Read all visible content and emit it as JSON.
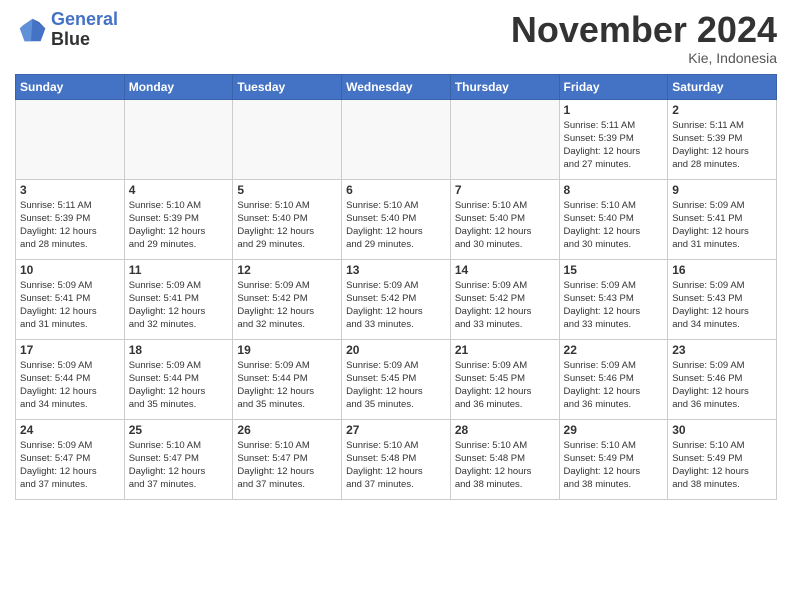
{
  "header": {
    "logo_line1": "General",
    "logo_line2": "Blue",
    "month": "November 2024",
    "location": "Kie, Indonesia"
  },
  "weekdays": [
    "Sunday",
    "Monday",
    "Tuesday",
    "Wednesday",
    "Thursday",
    "Friday",
    "Saturday"
  ],
  "weeks": [
    [
      {
        "day": "",
        "info": ""
      },
      {
        "day": "",
        "info": ""
      },
      {
        "day": "",
        "info": ""
      },
      {
        "day": "",
        "info": ""
      },
      {
        "day": "",
        "info": ""
      },
      {
        "day": "1",
        "info": "Sunrise: 5:11 AM\nSunset: 5:39 PM\nDaylight: 12 hours\nand 27 minutes."
      },
      {
        "day": "2",
        "info": "Sunrise: 5:11 AM\nSunset: 5:39 PM\nDaylight: 12 hours\nand 28 minutes."
      }
    ],
    [
      {
        "day": "3",
        "info": "Sunrise: 5:11 AM\nSunset: 5:39 PM\nDaylight: 12 hours\nand 28 minutes."
      },
      {
        "day": "4",
        "info": "Sunrise: 5:10 AM\nSunset: 5:39 PM\nDaylight: 12 hours\nand 29 minutes."
      },
      {
        "day": "5",
        "info": "Sunrise: 5:10 AM\nSunset: 5:40 PM\nDaylight: 12 hours\nand 29 minutes."
      },
      {
        "day": "6",
        "info": "Sunrise: 5:10 AM\nSunset: 5:40 PM\nDaylight: 12 hours\nand 29 minutes."
      },
      {
        "day": "7",
        "info": "Sunrise: 5:10 AM\nSunset: 5:40 PM\nDaylight: 12 hours\nand 30 minutes."
      },
      {
        "day": "8",
        "info": "Sunrise: 5:10 AM\nSunset: 5:40 PM\nDaylight: 12 hours\nand 30 minutes."
      },
      {
        "day": "9",
        "info": "Sunrise: 5:09 AM\nSunset: 5:41 PM\nDaylight: 12 hours\nand 31 minutes."
      }
    ],
    [
      {
        "day": "10",
        "info": "Sunrise: 5:09 AM\nSunset: 5:41 PM\nDaylight: 12 hours\nand 31 minutes."
      },
      {
        "day": "11",
        "info": "Sunrise: 5:09 AM\nSunset: 5:41 PM\nDaylight: 12 hours\nand 32 minutes."
      },
      {
        "day": "12",
        "info": "Sunrise: 5:09 AM\nSunset: 5:42 PM\nDaylight: 12 hours\nand 32 minutes."
      },
      {
        "day": "13",
        "info": "Sunrise: 5:09 AM\nSunset: 5:42 PM\nDaylight: 12 hours\nand 33 minutes."
      },
      {
        "day": "14",
        "info": "Sunrise: 5:09 AM\nSunset: 5:42 PM\nDaylight: 12 hours\nand 33 minutes."
      },
      {
        "day": "15",
        "info": "Sunrise: 5:09 AM\nSunset: 5:43 PM\nDaylight: 12 hours\nand 33 minutes."
      },
      {
        "day": "16",
        "info": "Sunrise: 5:09 AM\nSunset: 5:43 PM\nDaylight: 12 hours\nand 34 minutes."
      }
    ],
    [
      {
        "day": "17",
        "info": "Sunrise: 5:09 AM\nSunset: 5:44 PM\nDaylight: 12 hours\nand 34 minutes."
      },
      {
        "day": "18",
        "info": "Sunrise: 5:09 AM\nSunset: 5:44 PM\nDaylight: 12 hours\nand 35 minutes."
      },
      {
        "day": "19",
        "info": "Sunrise: 5:09 AM\nSunset: 5:44 PM\nDaylight: 12 hours\nand 35 minutes."
      },
      {
        "day": "20",
        "info": "Sunrise: 5:09 AM\nSunset: 5:45 PM\nDaylight: 12 hours\nand 35 minutes."
      },
      {
        "day": "21",
        "info": "Sunrise: 5:09 AM\nSunset: 5:45 PM\nDaylight: 12 hours\nand 36 minutes."
      },
      {
        "day": "22",
        "info": "Sunrise: 5:09 AM\nSunset: 5:46 PM\nDaylight: 12 hours\nand 36 minutes."
      },
      {
        "day": "23",
        "info": "Sunrise: 5:09 AM\nSunset: 5:46 PM\nDaylight: 12 hours\nand 36 minutes."
      }
    ],
    [
      {
        "day": "24",
        "info": "Sunrise: 5:09 AM\nSunset: 5:47 PM\nDaylight: 12 hours\nand 37 minutes."
      },
      {
        "day": "25",
        "info": "Sunrise: 5:10 AM\nSunset: 5:47 PM\nDaylight: 12 hours\nand 37 minutes."
      },
      {
        "day": "26",
        "info": "Sunrise: 5:10 AM\nSunset: 5:47 PM\nDaylight: 12 hours\nand 37 minutes."
      },
      {
        "day": "27",
        "info": "Sunrise: 5:10 AM\nSunset: 5:48 PM\nDaylight: 12 hours\nand 37 minutes."
      },
      {
        "day": "28",
        "info": "Sunrise: 5:10 AM\nSunset: 5:48 PM\nDaylight: 12 hours\nand 38 minutes."
      },
      {
        "day": "29",
        "info": "Sunrise: 5:10 AM\nSunset: 5:49 PM\nDaylight: 12 hours\nand 38 minutes."
      },
      {
        "day": "30",
        "info": "Sunrise: 5:10 AM\nSunset: 5:49 PM\nDaylight: 12 hours\nand 38 minutes."
      }
    ]
  ]
}
